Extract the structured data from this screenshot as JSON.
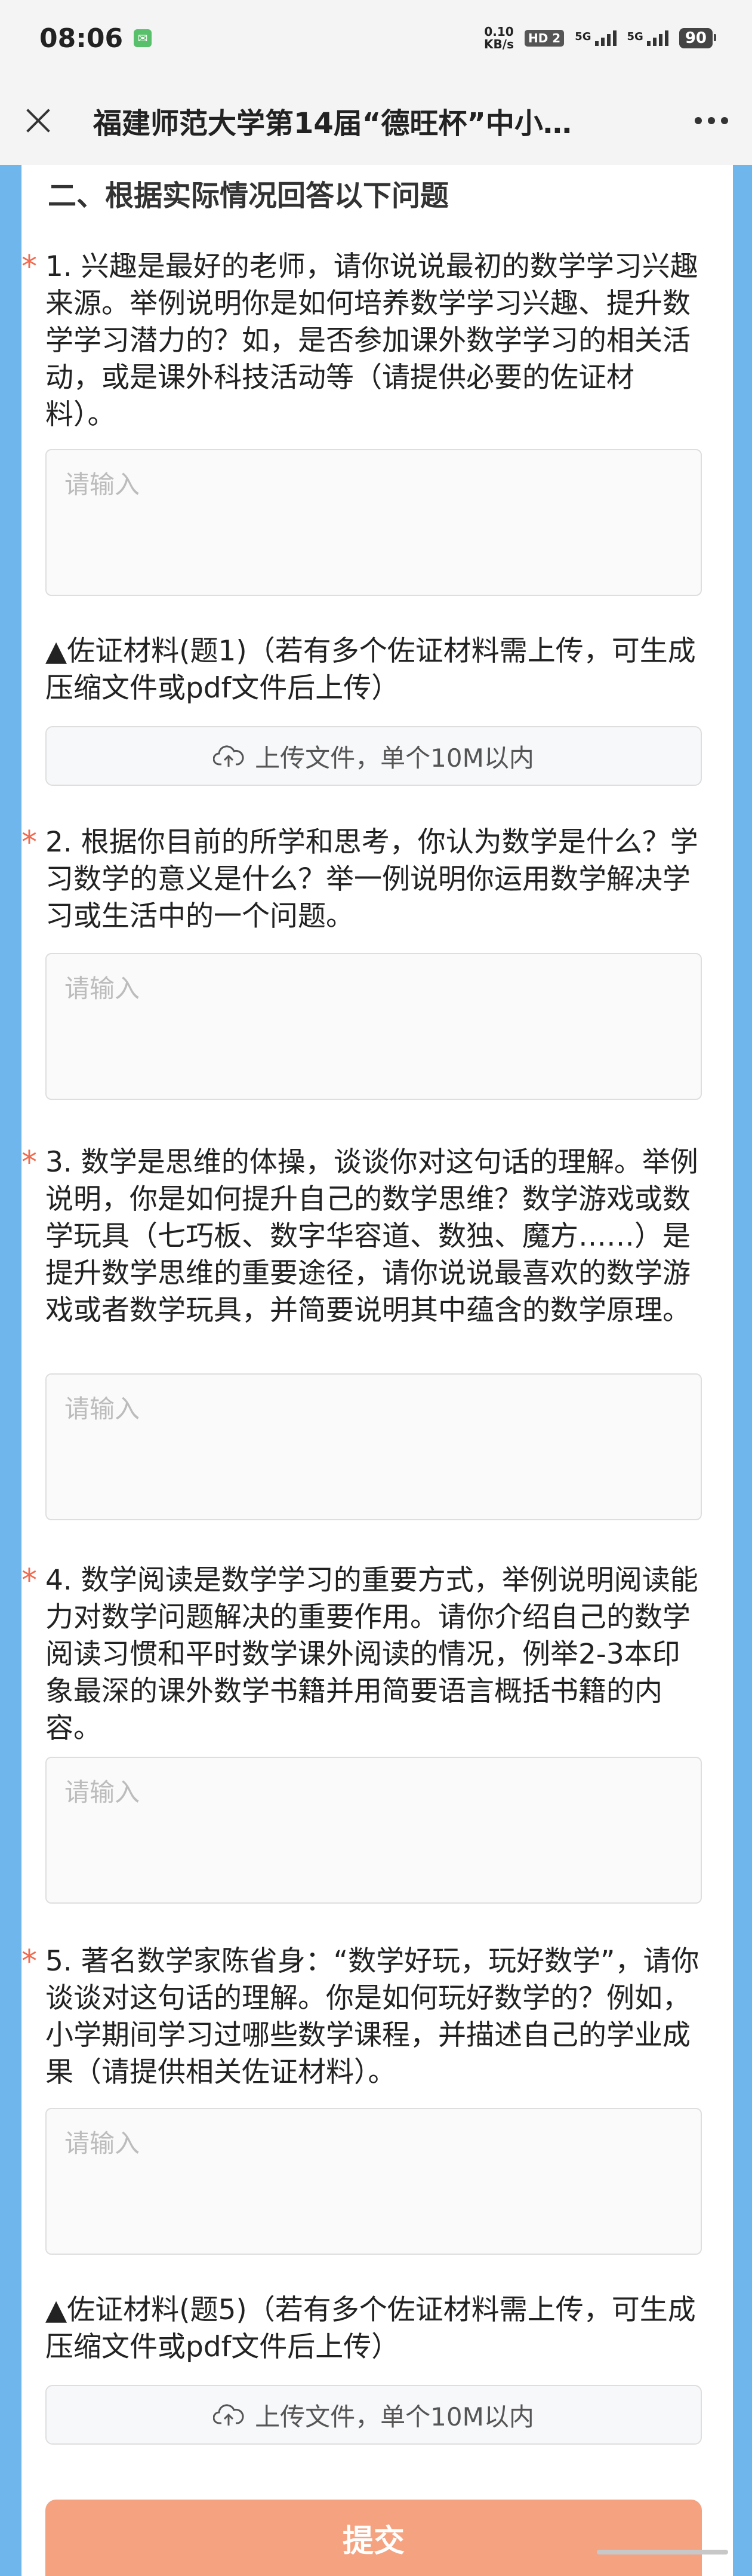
{
  "status_bar": {
    "time": "08:06",
    "app_icon": "message-app-icon",
    "net_speed_value": "0.10",
    "net_speed_unit": "KB/s",
    "hd_label": "HD 2",
    "signal_1_label": "5G",
    "signal_2_label": "5G",
    "battery": "90"
  },
  "title_bar": {
    "title": "福建师范大学第14届“德旺杯”中小…",
    "close_icon": "close-icon",
    "more_icon": "more-dots-icon"
  },
  "form": {
    "section_heading": "二、根据实际情况回答以下问题",
    "required_mark": "*",
    "questions": [
      {
        "text": "1. 兴趣是最好的老师，请你说说最初的数学学习兴趣来源。举例说明你是如何培养数学学习兴趣、提升数学学习潜力的？如，是否参加课外数学学习的相关活动，或是课外科技活动等（请提供必要的佐证材料）。",
        "placeholder": "请输入"
      },
      {
        "text": "2. 根据你目前的所学和思考，你认为数学是什么？学习数学的意义是什么？举一例说明你运用数学解决学习或生活中的一个问题。",
        "placeholder": "请输入"
      },
      {
        "text": "3. 数学是思维的体操，谈谈你对这句话的理解。举例说明，你是如何提升自己的数学思维？数学游戏或数学玩具（七巧板、数字华容道、数独、魔方……）是提升数学思维的重要途径，请你说说最喜欢的数学游戏或者数学玩具，并简要说明其中蕴含的数学原理。",
        "placeholder": "请输入"
      },
      {
        "text": "4. 数学阅读是数学学习的重要方式，举例说明阅读能力对数学问题解决的重要作用。请你介绍自己的数学阅读习惯和平时数学课外阅读的情况，例举2-3本印象最深的课外数学书籍并用简要语言概括书籍的内容。",
        "placeholder": "请输入"
      },
      {
        "text": "5. 著名数学家陈省身：“数学好玩，玩好数学”，请你谈谈对这句话的理解。你是如何玩好数学的？例如，小学期间学习过哪些数学课程，并描述自己的学业成果（请提供相关佐证材料）。",
        "placeholder": "请输入"
      }
    ],
    "material_1_label": "▲佐证材料(题1)（若有多个佐证材料需上传，可生成压缩文件或pdf文件后上传）",
    "material_5_label": "▲佐证材料(题5)（若有多个佐证材料需上传，可生成压缩文件或pdf文件后上传）",
    "upload_label": "上传文件，单个10M以内",
    "upload_icon": "cloud-upload-icon",
    "submit_label": "提交"
  },
  "colors": {
    "background": "#6fb6ec",
    "accent_submit": "#f4a27f",
    "required": "#ef6a4f"
  }
}
